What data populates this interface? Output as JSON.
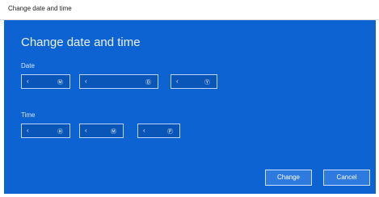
{
  "window": {
    "title": "Change date and time"
  },
  "dialog": {
    "heading": "Change date and time",
    "date": {
      "label": "Date",
      "month": "Ⓜ",
      "day": "Ⓓ",
      "year": "Ⓨ"
    },
    "time": {
      "label": "Time",
      "hour": "Ⓗ",
      "minute": "Ⓜ",
      "period": "Ⓟ"
    },
    "buttons": {
      "change": "Change",
      "cancel": "Cancel"
    }
  },
  "icons": {
    "field_arrow": "chevron-left-icon"
  },
  "colors": {
    "panel_blue": "#0d63d1",
    "field_bg": "#0a55b8",
    "button_bg": "#2f7ae0"
  }
}
